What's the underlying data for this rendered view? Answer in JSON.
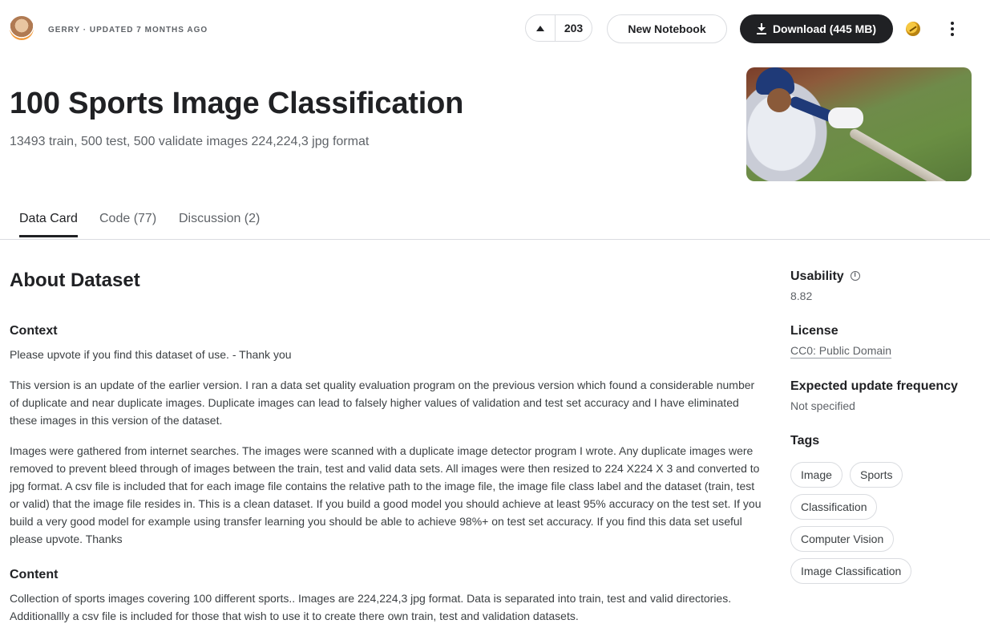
{
  "header": {
    "author_meta": "GERRY · UPDATED 7 MONTHS AGO",
    "upvote_count": "203",
    "new_notebook_label": "New Notebook",
    "download_label": "Download (445 MB)"
  },
  "dataset": {
    "title": "100 Sports Image Classification",
    "subtitle": "13493 train, 500 test, 500 validate images 224,224,3 jpg format"
  },
  "tabs": [
    {
      "label": "Data Card",
      "active": true
    },
    {
      "label": "Code (77)",
      "active": false
    },
    {
      "label": "Discussion (2)",
      "active": false
    }
  ],
  "about": {
    "heading": "About Dataset",
    "context_heading": "Context",
    "context_p1": "Please upvote if you find this dataset of use. - Thank you",
    "context_p2": "This version is an update of the earlier version. I ran a data set quality evaluation program on the previous version which found a considerable number of duplicate and near duplicate images. Duplicate images can lead to falsely higher values of validation and test set accuracy and I have eliminated these images in this version of the dataset.",
    "context_p3": "Images were gathered from internet searches. The images were scanned with a duplicate image detector program I wrote. Any duplicate images were removed to prevent bleed through of images between the train, test and valid data sets. All images were then resized to 224 X224 X 3 and converted to jpg format. A csv file is included that for each image file contains the relative path to the image file, the image file class label and the dataset (train, test or valid) that the image file resides in. This is a clean dataset. If you build a good model you should achieve at least 95% accuracy on the test set. If you build a very good model for example using transfer learning you should be able to achieve 98%+ on test set accuracy. If you find this data set useful please upvote. Thanks",
    "content_heading": "Content",
    "content_p1": "Collection of sports images covering 100 different sports.. Images are 224,224,3 jpg format. Data is separated into train, test and valid directories. Additionallly a csv file is included for those that wish to use it to create there own train, test and validation datasets."
  },
  "sidebar": {
    "usability_label": "Usability",
    "usability_value": "8.82",
    "license_label": "License",
    "license_value": "CC0: Public Domain",
    "frequency_label": "Expected update frequency",
    "frequency_value": "Not specified",
    "tags_label": "Tags",
    "tags": [
      "Image",
      "Sports",
      "Classification",
      "Computer Vision",
      "Image Classification"
    ]
  },
  "icons": {
    "upvote": "triangle-up-icon",
    "download": "download-icon",
    "medal": "medal-icon",
    "more": "kebab-menu-icon",
    "info": "info-icon"
  },
  "colors": {
    "primary_button": "#202124",
    "text_primary": "#202124",
    "text_secondary": "#5f6368",
    "border": "#dadce0",
    "medal_gold": "#f6c842"
  }
}
